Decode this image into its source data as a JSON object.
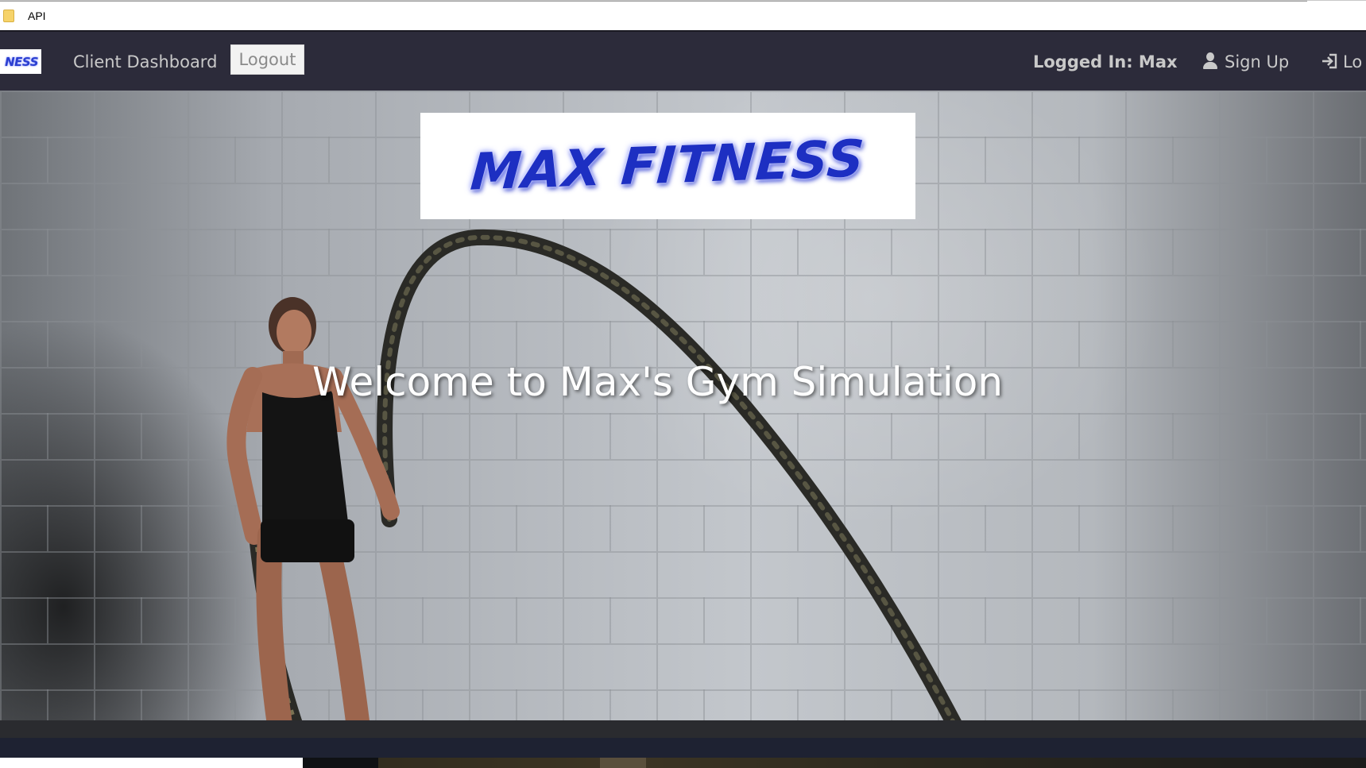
{
  "bookmarks_bar": {
    "items": [
      {
        "icon": "folder-icon",
        "label": "API"
      }
    ]
  },
  "navbar": {
    "brand_text": "NESS",
    "client_dashboard_label": "Client Dashboard",
    "logout_label": "Logout",
    "logged_in_text": "Logged In: Max",
    "sign_up_label": "Sign Up",
    "login_label": "Lo",
    "colors": {
      "background": "#2c2b3a",
      "link": "#c9c9c9"
    }
  },
  "hero": {
    "logo_text": "MAX FITNESS",
    "welcome_text": "Welcome to Max's Gym Simulation",
    "logo_color": "#1d2fc2"
  }
}
